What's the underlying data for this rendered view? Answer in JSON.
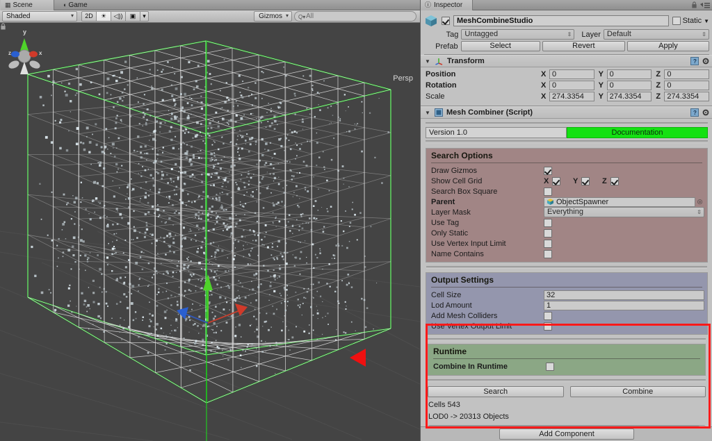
{
  "scene": {
    "tabs": [
      {
        "label": "Scene",
        "icon": "grid-icon",
        "active": true
      },
      {
        "label": "Game",
        "icon": "gamepad-icon",
        "active": false
      }
    ],
    "toolbar": {
      "shading_mode": "Shaded",
      "mode_2d": "2D",
      "lighting_icon": "sun-icon",
      "audio_icon": "speaker-icon",
      "fx_icon": "image-icon",
      "fx_dropdown_icon": "chevron-down-icon",
      "gizmos_label": "Gizmos",
      "search_placeholder": "All",
      "search_value": "All",
      "search_icon": "search-icon"
    },
    "viewport": {
      "projection_label": "Persp",
      "axis_labels": {
        "x": "x",
        "y": "y",
        "z": "z"
      },
      "lock_icon": "lock-icon",
      "background_color": "#444444",
      "bounds_color": "#00c800",
      "wireframe_color": "#e8e8e8",
      "gizmo_axis_colors": {
        "x": "#d03a2a",
        "y": "#4fd22a",
        "z": "#2a5fd0"
      },
      "annotation_arrow_icon": "red-triangle-annotation"
    }
  },
  "inspector": {
    "tab_label": "Inspector",
    "tab_icon": "info-icon",
    "lock_icon": "lock-icon",
    "menu_icon": "hamburger-icon",
    "gameobject": {
      "icon": "cube-icon",
      "enabled": true,
      "name": "MeshCombineStudio",
      "static_label": "Static",
      "static_checked": false,
      "static_dropdown_icon": "chevron-down-icon",
      "tag_label": "Tag",
      "tag_value": "Untagged",
      "layer_label": "Layer",
      "layer_value": "Default",
      "prefab_label": "Prefab",
      "prefab_buttons": [
        "Select",
        "Revert",
        "Apply"
      ]
    },
    "transform": {
      "title": "Transform",
      "icon": "transform-icon",
      "help_icon": "help-icon",
      "settings_icon": "gear-icon",
      "rows": [
        {
          "label": "Position",
          "x": "0",
          "y": "0",
          "z": "0"
        },
        {
          "label": "Rotation",
          "x": "0",
          "y": "0",
          "z": "0"
        },
        {
          "label": "Scale",
          "x": "274.3354",
          "y": "274.3354",
          "z": "274.3354"
        }
      ],
      "axis_labels": [
        "X",
        "Y",
        "Z"
      ]
    },
    "mesh_combiner": {
      "title": "Mesh Combiner (Script)",
      "icon": "script-icon",
      "help_icon": "help-icon",
      "settings_icon": "gear-icon",
      "version": "Version 1.0",
      "documentation_label": "Documentation",
      "documentation_color": "#14e112",
      "search_options": {
        "title": "Search Options",
        "panel_color": "#a18585",
        "draw_gizmos": {
          "label": "Draw Gizmos",
          "checked": true
        },
        "show_cell_grid": {
          "label": "Show Cell Grid",
          "axes": [
            {
              "label": "X",
              "checked": true
            },
            {
              "label": "Y",
              "checked": true
            },
            {
              "label": "Z",
              "checked": true
            }
          ]
        },
        "search_box_square": {
          "label": "Search Box Square",
          "checked": false
        },
        "parent": {
          "label": "Parent",
          "value": "ObjectSpawner",
          "icon": "gameobject-icon",
          "picker_icon": "object-picker-icon"
        },
        "layer_mask": {
          "label": "Layer Mask",
          "value": "Everything"
        },
        "use_tag": {
          "label": "Use Tag",
          "checked": false
        },
        "only_static": {
          "label": "Only Static",
          "checked": false
        },
        "use_vertex_input_limit": {
          "label": "Use Vertex Input Limit",
          "checked": false
        },
        "name_contains": {
          "label": "Name Contains",
          "checked": false
        }
      },
      "output_settings": {
        "title": "Output Settings",
        "panel_color": "#9496ad",
        "cell_size": {
          "label": "Cell Size",
          "value": "32"
        },
        "lod_amount": {
          "label": "Lod Amount",
          "value": "1"
        },
        "add_mesh_colliders": {
          "label": "Add Mesh Colliders",
          "checked": false
        },
        "use_vertex_output_limit": {
          "label": "Use Vertex Output Limit",
          "checked": false
        }
      },
      "runtime": {
        "title": "Runtime",
        "panel_color": "#8ba785",
        "combine_in_runtime": {
          "label": "Combine In Runtime",
          "checked": false
        },
        "highlight_color": "#ff1a1a",
        "annotation_arrow_icon": "red-arrow-pointing-left"
      },
      "actions": {
        "search_label": "Search",
        "combine_label": "Combine"
      },
      "status": {
        "cells": "Cells 543",
        "lod": "LOD0 -> 20313 Objects"
      }
    },
    "add_component_label": "Add Component"
  }
}
